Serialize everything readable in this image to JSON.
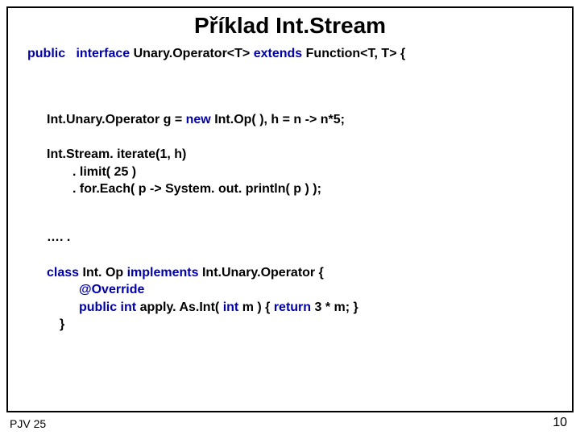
{
  "title": "Příklad   Int.Stream",
  "line1": {
    "kw1": "public",
    "kw2": "interface",
    "t1": "Unary.Operator<T> ",
    "kw3": "extends",
    "t2": " Function<T, T> {"
  },
  "line2": {
    "t1": "Int.Unary.Operator  g = ",
    "kw1": "new",
    "t2": " Int.Op( ),  h = n -> n*5;"
  },
  "block1": {
    "l1": "Int.Stream. iterate(1, h)",
    "l2": ". limit( 25 )",
    "l3": ". for.Each( p -> System. out. println( p ) );"
  },
  "dots": "…. .",
  "block2": {
    "l1_a": "class",
    "l1_b": " Int. Op ",
    "l1_c": "implements",
    "l1_d": " Int.Unary.Operator {",
    "l2": "@Override",
    "l3_a": "public int",
    "l3_b": " apply. As.Int( ",
    "l3_c": "int",
    "l3_d": " m ) { ",
    "l3_e": "return",
    "l3_f": " 3 * m; }",
    "l4": "}"
  },
  "footer": {
    "left": "PJV 25",
    "right": "10"
  }
}
